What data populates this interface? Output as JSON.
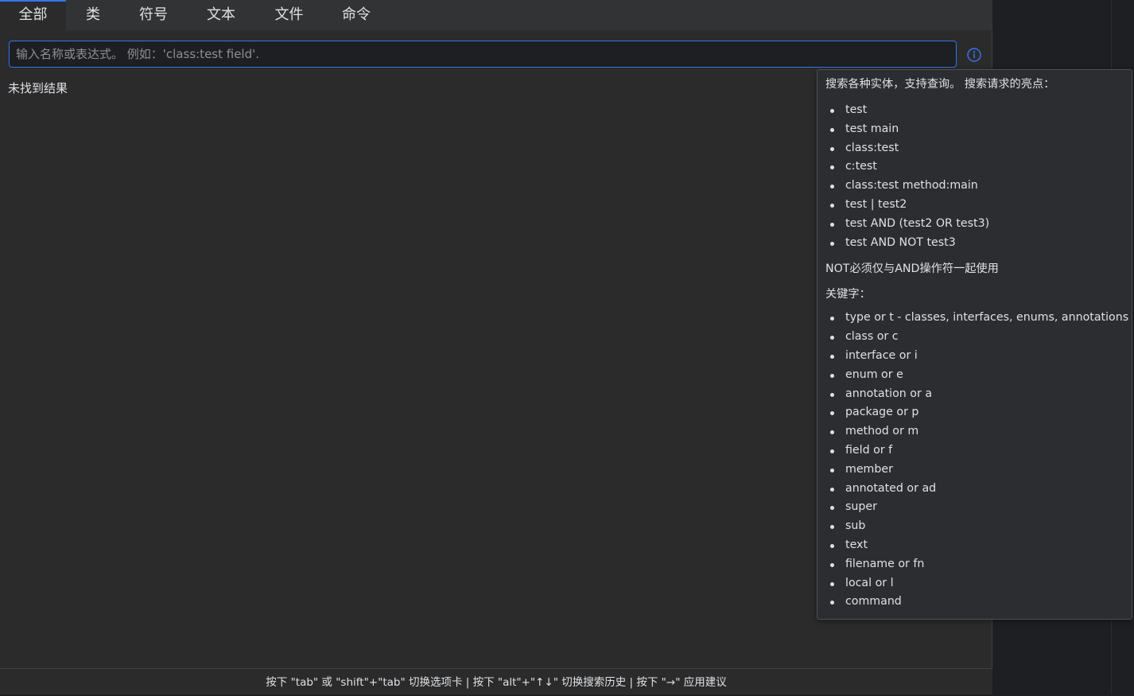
{
  "tabs": [
    {
      "label": "全部",
      "active": true
    },
    {
      "label": "类",
      "active": false
    },
    {
      "label": "符号",
      "active": false
    },
    {
      "label": "文本",
      "active": false
    },
    {
      "label": "文件",
      "active": false
    },
    {
      "label": "命令",
      "active": false
    }
  ],
  "search": {
    "value": "",
    "placeholder": "输入名称或表达式。 例如：'class:test field'."
  },
  "results": {
    "empty_text": "未找到结果"
  },
  "info_button": {
    "icon": "info-icon",
    "color": "#3574f0"
  },
  "help": {
    "intro": "搜索各种实体，支持查询。 搜索请求的亮点：",
    "examples": [
      "test",
      "test main",
      "class:test",
      "c:test",
      "class:test method:main",
      "test | test2",
      "test AND (test2 OR test3)",
      "test AND NOT test3"
    ],
    "not_note": "NOT必须仅与AND操作符一起使用",
    "keywords_title": "关键字：",
    "keywords": [
      "type or t - classes, interfaces, enums, annotations",
      "class or c",
      "interface or i",
      "enum or e",
      "annotation or a",
      "package or p",
      "method or m",
      "field or f",
      "member",
      "annotated or ad",
      "super",
      "sub",
      "text",
      "filename or fn",
      "local or l",
      "command"
    ]
  },
  "footer": {
    "hint": "按下 \"tab\" 或 \"shift\"+\"tab\" 切换选项卡 | 按下 \"alt\"+\"↑↓\" 切换搜索历史 | 按下 \"→\" 应用建议"
  },
  "colors": {
    "accent": "#3574f0",
    "background": "#2b2b2b",
    "text": "#dfe1e5"
  }
}
